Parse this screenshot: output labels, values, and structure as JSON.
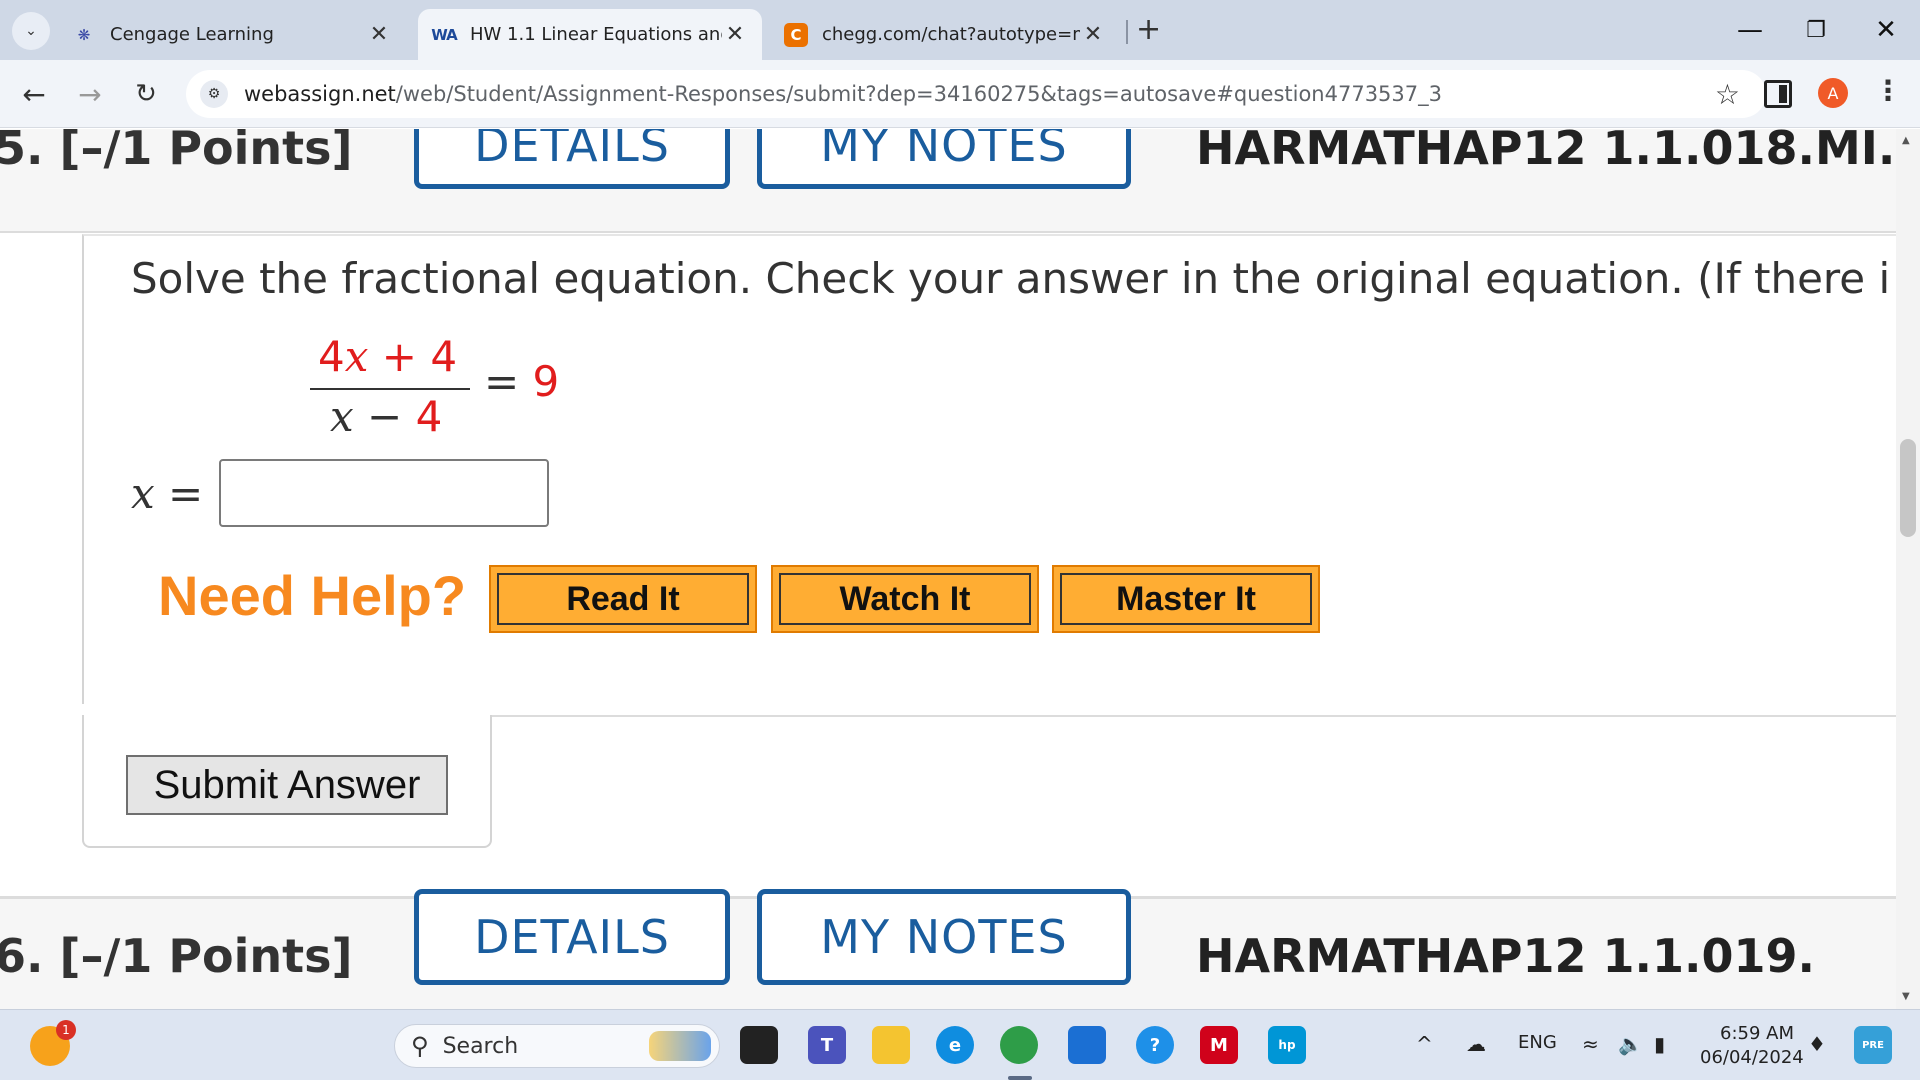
{
  "browser": {
    "tabs": [
      {
        "title": "Cengage Learning",
        "active": false
      },
      {
        "title": "HW 1.1 Linear Equations and In",
        "active": true
      },
      {
        "title": "chegg.com/chat?autotype=mix",
        "active": false
      }
    ],
    "url_host": "webassign.net",
    "url_path": "/web/Student/Assignment-Responses/submit?dep=34160275&tags=autosave#question4773537_3",
    "avatar_letter": "A"
  },
  "top_header": {
    "points": "5. [–/1 Points]",
    "details": "DETAILS",
    "my_notes": "MY NOTES",
    "code": "HARMATHAP12 1.1.018.MI."
  },
  "question": {
    "prompt": "Solve the fractional equation. Check your answer in the original equation. (If there i",
    "equation": {
      "num_coef": "4",
      "num_var": "x",
      "num_op": " + ",
      "num_const": "4",
      "den_var": "x",
      "den_op": " − ",
      "den_const": "4",
      "equals": "= ",
      "rhs": "9"
    },
    "answer_var": "x",
    "answer_eq": " =",
    "answer_value": ""
  },
  "help": {
    "label": "Need Help?",
    "read_it": "Read It",
    "watch_it": "Watch It",
    "master_it": "Master It"
  },
  "submit_label": "Submit Answer",
  "bottom_header": {
    "points": "6. [–/1 Points]",
    "details": "DETAILS",
    "my_notes": "MY NOTES",
    "code": "HARMATHAP12 1.1.019."
  },
  "taskbar": {
    "weather_badge": "1",
    "search_placeholder": "Search",
    "lang": "ENG",
    "time": "6:59 AM",
    "date": "06/04/2024"
  },
  "colors": {
    "accent_blue": "#1a5d9e",
    "math_red": "#e11d1d",
    "help_orange": "#f7891f",
    "button_orange": "#ffad33"
  }
}
